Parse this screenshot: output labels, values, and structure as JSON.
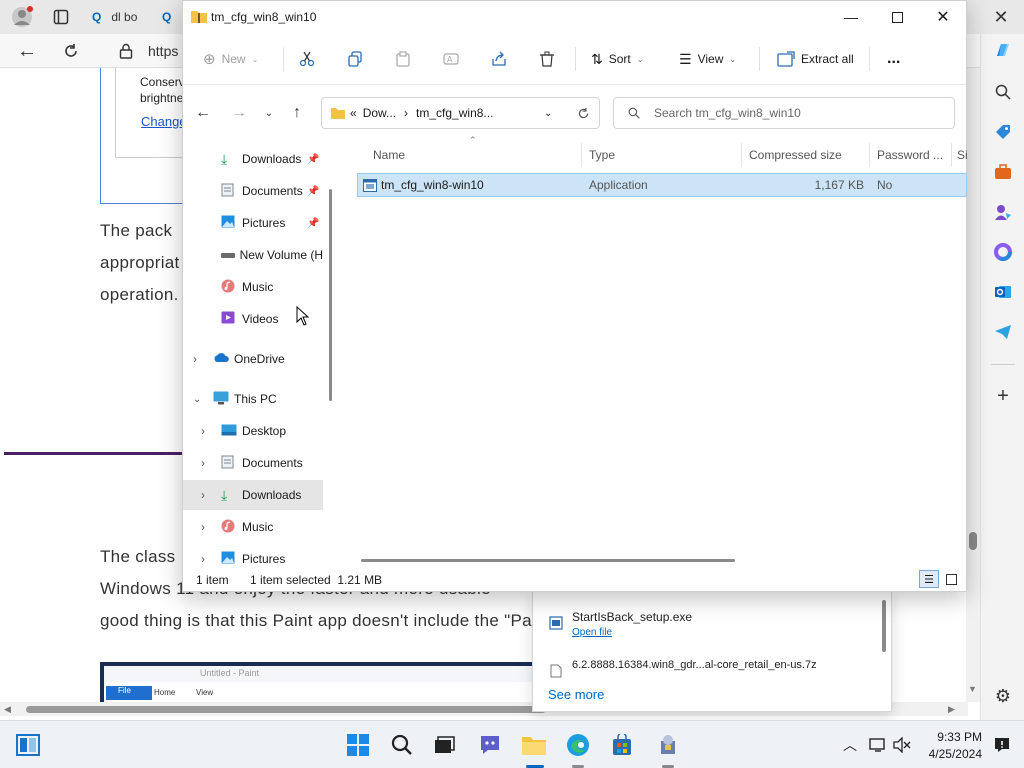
{
  "browser": {
    "tabs": [
      {
        "label": "dl bo"
      }
    ],
    "url": "https",
    "article": {
      "card_text": "Conserv brightne",
      "card_link": "Change",
      "para1_line1": "The pack",
      "para1_line2": "appropriat",
      "para1_line3": "operation.",
      "para2_line1": "The class",
      "para2_line2": "Windows 11 and enjoy the faster and more usable",
      "para2_line3": "good thing is that this Paint app doesn't include the \"Pa",
      "paint_title": "Untitled - Paint",
      "paint_tabs": [
        "File",
        "Home",
        "View"
      ]
    }
  },
  "explorer": {
    "title": "tm_cfg_win8_win10",
    "toolbar": {
      "new_label": "New",
      "sort_label": "Sort",
      "view_label": "View",
      "extract_label": "Extract all",
      "more_label": "..."
    },
    "path": {
      "prefix": "«",
      "seg1": "Dow...",
      "seg2": "tm_cfg_win8..."
    },
    "search_placeholder": "Search tm_cfg_win8_win10",
    "nav": {
      "quick": [
        "Downloads",
        "Documents",
        "Pictures",
        "New Volume (H",
        "Music",
        "Videos"
      ],
      "onedrive": "OneDrive",
      "thispc": "This PC",
      "pc_items": [
        "Desktop",
        "Documents",
        "Downloads",
        "Music",
        "Pictures"
      ]
    },
    "columns": [
      "Name",
      "Type",
      "Compressed size",
      "Password ...",
      "Si"
    ],
    "files": [
      {
        "name": "tm_cfg_win8-win10",
        "type": "Application",
        "size": "1,167 KB",
        "password": "No"
      }
    ],
    "status": {
      "count": "1 item",
      "selected": "1 item selected  1.21 MB"
    }
  },
  "downloads_panel": {
    "item1_name": "StartIsBack_setup.exe",
    "item1_action": "Open file",
    "item2_name": "6.2.8888.16384.win8_gdr...al-core_retail_en-us.7z",
    "see_more": "See more"
  },
  "taskbar": {
    "time": "9:33 PM",
    "date": "4/25/2024"
  },
  "colors": {
    "accent": "#0067c0",
    "selection": "#cce4f7",
    "purple_rule": "#4b1f63"
  }
}
